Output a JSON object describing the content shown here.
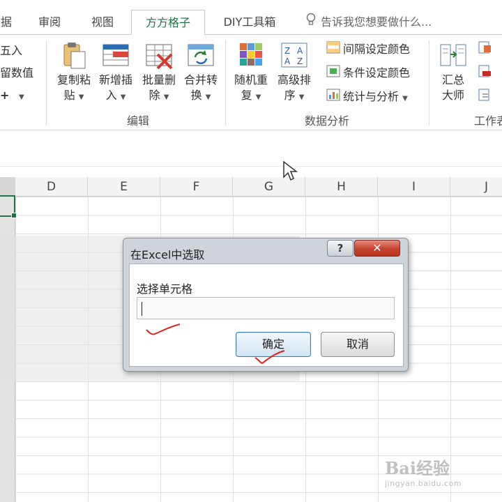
{
  "tabs": [
    {
      "label": "据"
    },
    {
      "label": "审阅"
    },
    {
      "label": "视图"
    },
    {
      "label": "方方格子",
      "active": true
    },
    {
      "label": "DIY工具箱"
    }
  ],
  "tell_me": {
    "text": "告诉我您想要做什么..."
  },
  "ribbon": {
    "left_partial": {
      "round": "五入",
      "keep_value": "留数值",
      "plus_label": "+"
    },
    "edit_group": {
      "label": "编辑",
      "buttons": [
        {
          "line1": "复制粘",
          "line2": "贴"
        },
        {
          "line1": "新增插",
          "line2": "入"
        },
        {
          "line1": "批量删",
          "line2": "除"
        },
        {
          "line1": "合并转",
          "line2": "换"
        }
      ]
    },
    "analysis_group": {
      "label": "数据分析",
      "buttons": [
        {
          "line1": "随机重",
          "line2": "复"
        },
        {
          "line1": "高级排",
          "line2": "序"
        }
      ],
      "small_buttons": [
        {
          "label": "间隔设定颜色"
        },
        {
          "label": "条件设定颜色"
        },
        {
          "label": "统计与分析"
        }
      ]
    },
    "summary_group": {
      "label": "工作表",
      "big_button": {
        "line1": "汇总",
        "line2": "大师"
      }
    }
  },
  "sheet": {
    "columns": [
      "D",
      "E",
      "F",
      "G",
      "H",
      "I",
      "J"
    ]
  },
  "dialog": {
    "title": "在Excel中选取",
    "help_label": "?",
    "close_label": "✕",
    "field_label": "选择单元格",
    "field_value": "",
    "ok_label": "确定",
    "cancel_label": "取消"
  },
  "watermark": {
    "main": "Bai经验",
    "sub": "jingyan.baidu.com"
  }
}
